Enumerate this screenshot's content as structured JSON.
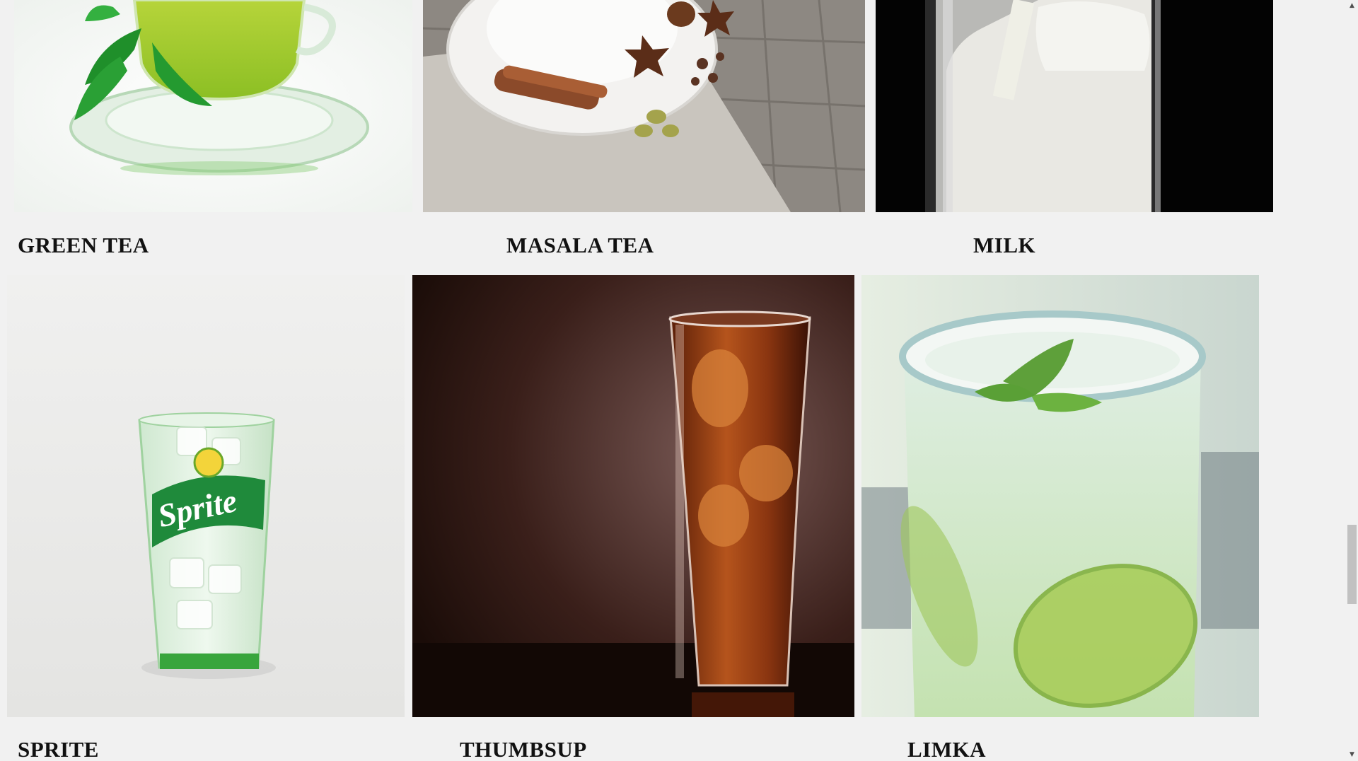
{
  "menu": {
    "items": [
      {
        "name": "GREEN TEA",
        "image_icon": "green-tea-cup-photo"
      },
      {
        "name": "MASALA TEA",
        "image_icon": "masala-tea-spices-photo"
      },
      {
        "name": "MILK",
        "image_icon": "milk-glass-photo"
      },
      {
        "name": "SPRITE",
        "image_icon": "sprite-glass-photo"
      },
      {
        "name": "THUMBSUP",
        "image_icon": "cola-glass-photo"
      },
      {
        "name": "LIMKA",
        "image_icon": "lemon-drink-glass-photo"
      }
    ]
  },
  "scrollbar": {
    "up_icon": "▲",
    "down_icon": "▼"
  },
  "colors": {
    "page_background": "#f1f1f1",
    "label_text": "#111111",
    "scroll_thumb": "#c1c1c1"
  }
}
